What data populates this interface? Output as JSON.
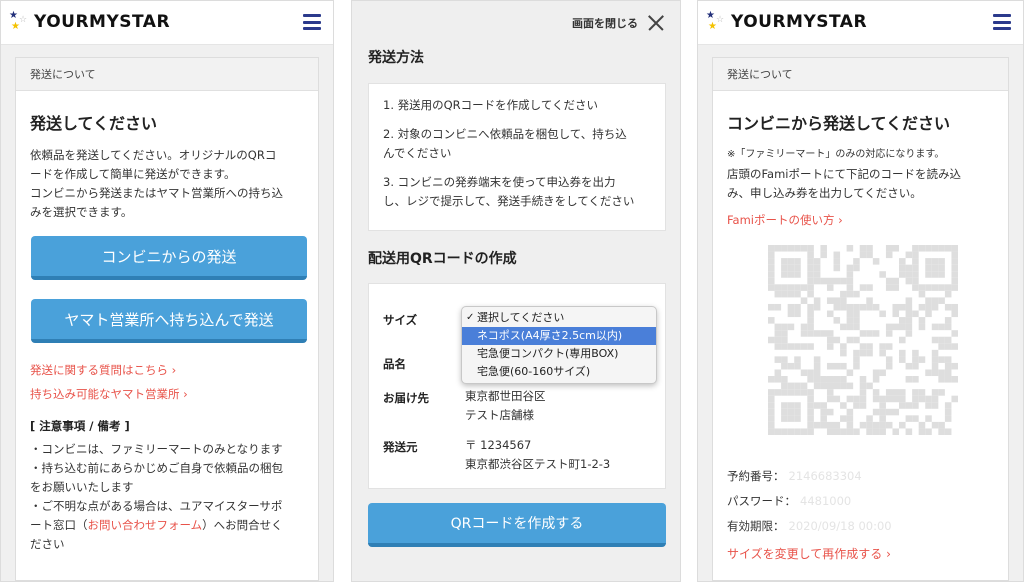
{
  "screen1": {
    "logo": "YOURMYSTAR",
    "card_header": "発送について",
    "title": "発送してください",
    "desc_lines": [
      "依頼品を発送してください。オリジナルのQRコ",
      "ードを作成して簡単に発送ができます。",
      "コンビニから発送またはヤマト営業所への持ち込",
      "みを選択できます。"
    ],
    "btn_convenience": "コンビニからの発送",
    "btn_yamato": "ヤマト営業所へ持ち込んで発送",
    "link_faq": "発送に関する質問はこちら ›",
    "link_offices": "持ち込み可能なヤマト営業所 ›",
    "notes_title": "[ 注意事項 / 備考 ]",
    "note1": "・コンビニは、ファミリーマートのみとなります",
    "note2a": "・持ち込む前にあらかじめご自身で依頼品の梱包",
    "note2b": "をお願いいたします",
    "note3a": "・ご不明な点がある場合は、ユアマイスターサポ",
    "note3b_pre": "ート窓口（",
    "note3b_link": "お問い合わせフォーム",
    "note3b_post": "）へお問合せく",
    "note3c": "ださい"
  },
  "screen2": {
    "close_label": "画面を閉じる",
    "method_title": "発送方法",
    "step1": "1. 発送用のQRコードを作成してください",
    "step2a": "2. 対象のコンビニへ依頼品を梱包して、持ち込",
    "step2b": "んでください",
    "step3a": "3. コンビニの発券端末を使って申込券を出力",
    "step3b": "し、レジで提示して、発送手続きをしてください",
    "qr_title": "配送用QRコードの作成",
    "label_size": "サイズ",
    "label_item": "品名",
    "label_dest": "お届け先",
    "dest_line1": "東京都世田谷区",
    "dest_line2": "テスト店舗様",
    "label_from": "発送元",
    "from_line1": "〒 1234567",
    "from_line2": "東京都渋谷区テスト町1-2-3",
    "size_options": [
      "選択してください",
      "ネコポス(A4厚さ2.5cm以内)",
      "宅急便コンパクト(専用BOX)",
      "宅急便(60-160サイズ)"
    ],
    "check_mark": "✓",
    "btn_create": "QRコードを作成する"
  },
  "screen3": {
    "logo": "YOURMYSTAR",
    "card_header": "発送について",
    "title": "コンビニから発送してください",
    "note_small": "※「ファミリーマート」のみの対応になります。",
    "desc_a": "店頭のFamiポートにて下記のコードを読み込",
    "desc_b": "み、申し込み券を出力してください。",
    "link_famiport": "Famiポートの使い方 ›",
    "label_reservation": "予約番号：",
    "value_reservation": "2146683304",
    "label_password": "パスワード：",
    "value_password": "4481000",
    "label_expiry": "有効期限：",
    "value_expiry": "2020/09/18 00:00",
    "link_remake": "サイズを変更して再作成する ›"
  },
  "colors": {
    "primary_blue": "#4aa1da",
    "link_red": "#e8534a",
    "navy": "#2b3a8c"
  }
}
